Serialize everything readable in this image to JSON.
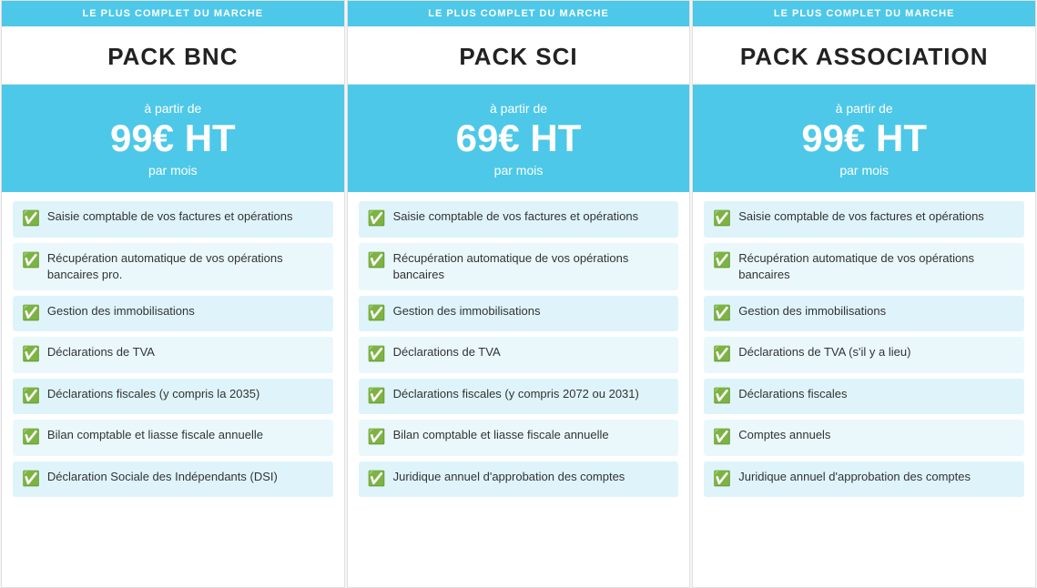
{
  "cards": [
    {
      "badge": "LE PLUS COMPLET DU MARCHE",
      "title": "PACK BNC",
      "price_from": "à partir de",
      "price": "99€ HT",
      "price_per": "par mois",
      "features": [
        "Saisie comptable de vos factures et opérations",
        "Récupération automatique de vos opérations bancaires pro.",
        "Gestion des immobilisations",
        "Déclarations de TVA",
        "Déclarations fiscales (y compris la 2035)",
        "Bilan comptable et liasse fiscale annuelle",
        "Déclaration Sociale des Indépendants (DSI)"
      ]
    },
    {
      "badge": "LE PLUS COMPLET DU MARCHE",
      "title": "PACK SCI",
      "price_from": "à partir de",
      "price": "69€ HT",
      "price_per": "par mois",
      "features": [
        "Saisie comptable de vos factures et opérations",
        "Récupération automatique de vos opérations bancaires",
        "Gestion des immobilisations",
        "Déclarations de TVA",
        "Déclarations fiscales (y compris 2072 ou 2031)",
        "Bilan comptable et liasse fiscale annuelle",
        "Juridique annuel d'approbation des comptes"
      ]
    },
    {
      "badge": "LE PLUS COMPLET DU MARCHE",
      "title": "PACK ASSOCIATION",
      "price_from": "à partir de",
      "price": "99€ HT",
      "price_per": "par mois",
      "features": [
        "Saisie comptable de vos factures et opérations",
        "Récupération automatique de vos opérations bancaires",
        "Gestion des immobilisations",
        "Déclarations de TVA (s'il y a lieu)",
        "Déclarations fiscales",
        "Comptes annuels",
        "Juridique annuel d'approbation des comptes"
      ]
    }
  ],
  "check_symbol": "✅"
}
